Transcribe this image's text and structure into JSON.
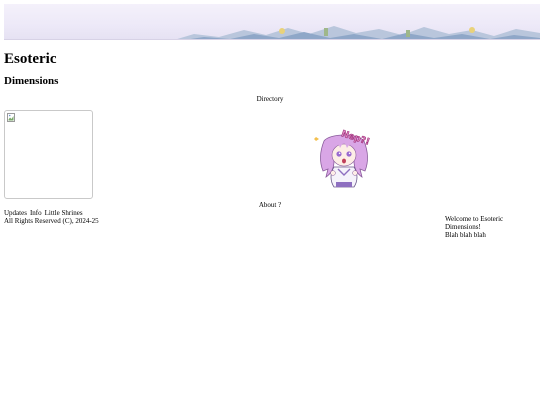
{
  "header": {
    "title": "Esoteric",
    "subtitle": "Dimensions"
  },
  "nav": {
    "directory_label": "Directory",
    "about_label": "About ?"
  },
  "images": {
    "banner_icon": "anime-town-banner",
    "placeholder_icon": "broken-image-icon",
    "mascot_icon": "nep-mascot-sticker",
    "mascot_text": "Nep?!"
  },
  "footer": {
    "links": [
      "Updates",
      "Info",
      "Little Shrines"
    ],
    "copyright": "All Rights Reserved (C), 2024-25",
    "welcome": "Welcome to Esoteric Dimensions!",
    "blurb": "Blah blah blah"
  },
  "colors": {
    "banner_bg": "#ede9f8",
    "mascot_hair": "#d9a6e6",
    "mascot_text": "#c2559e"
  }
}
